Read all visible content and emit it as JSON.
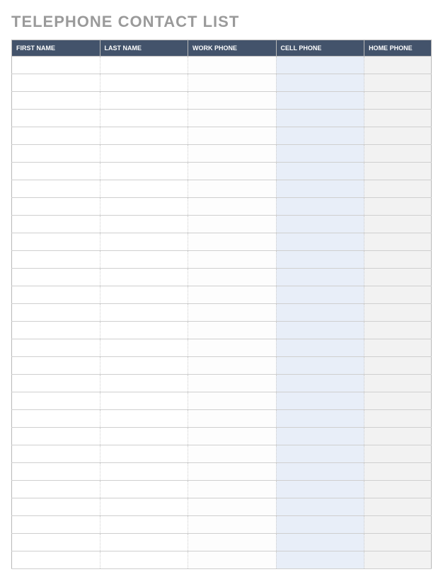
{
  "title": "TELEPHONE CONTACT LIST",
  "columns": [
    {
      "label": "FIRST NAME"
    },
    {
      "label": "LAST NAME"
    },
    {
      "label": "WORK PHONE"
    },
    {
      "label": "CELL PHONE"
    },
    {
      "label": "HOME PHONE"
    }
  ],
  "row_count": 29,
  "rows": []
}
